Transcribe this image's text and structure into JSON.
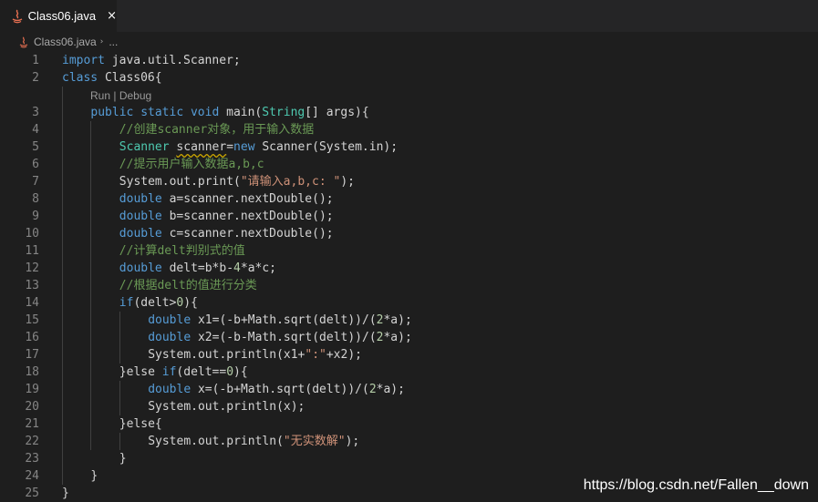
{
  "tab": {
    "label": "Class06.java",
    "close": "×"
  },
  "breadcrumb": {
    "file": "Class06.java",
    "separator": "›",
    "more": "..."
  },
  "codelens": {
    "run": "Run",
    "separator": " | ",
    "debug": "Debug"
  },
  "lines": [
    {
      "n": "1",
      "indent": 0,
      "tokens": [
        {
          "t": "import",
          "c": "kw"
        },
        {
          "t": " java.util.Scanner;"
        }
      ]
    },
    {
      "n": "2",
      "indent": 0,
      "tokens": [
        {
          "t": "class",
          "c": "kw"
        },
        {
          "t": " Class06{"
        }
      ]
    },
    {
      "n": "3",
      "indent": 1,
      "tokens": [
        {
          "t": "public",
          "c": "kw"
        },
        {
          "t": " "
        },
        {
          "t": "static",
          "c": "kw"
        },
        {
          "t": " "
        },
        {
          "t": "void",
          "c": "kw"
        },
        {
          "t": " main("
        },
        {
          "t": "String",
          "c": "type"
        },
        {
          "t": "[] args){"
        }
      ]
    },
    {
      "n": "4",
      "indent": 2,
      "tokens": [
        {
          "t": "//创建scanner对象，用于输入数据",
          "c": "comment"
        }
      ]
    },
    {
      "n": "5",
      "indent": 2,
      "tokens": [
        {
          "t": "Scanner",
          "c": "type"
        },
        {
          "t": " "
        },
        {
          "t": "scanner",
          "c": "warn"
        },
        {
          "t": "="
        },
        {
          "t": "new",
          "c": "kw"
        },
        {
          "t": " Scanner(System.in);"
        }
      ]
    },
    {
      "n": "6",
      "indent": 2,
      "tokens": [
        {
          "t": "//提示用户输入数据a,b,c",
          "c": "comment"
        }
      ]
    },
    {
      "n": "7",
      "indent": 2,
      "tokens": [
        {
          "t": "System.out.print("
        },
        {
          "t": "\"请输入a,b,c: \"",
          "c": "str"
        },
        {
          "t": ");"
        }
      ]
    },
    {
      "n": "8",
      "indent": 2,
      "tokens": [
        {
          "t": "double",
          "c": "kw"
        },
        {
          "t": " a=scanner.nextDouble();"
        }
      ]
    },
    {
      "n": "9",
      "indent": 2,
      "tokens": [
        {
          "t": "double",
          "c": "kw"
        },
        {
          "t": " b=scanner.nextDouble();"
        }
      ]
    },
    {
      "n": "10",
      "indent": 2,
      "tokens": [
        {
          "t": "double",
          "c": "kw"
        },
        {
          "t": " c=scanner.nextDouble();"
        }
      ]
    },
    {
      "n": "11",
      "indent": 2,
      "tokens": [
        {
          "t": "//计算delt判别式的值",
          "c": "comment"
        }
      ]
    },
    {
      "n": "12",
      "indent": 2,
      "tokens": [
        {
          "t": "double",
          "c": "kw"
        },
        {
          "t": " delt=b*b-"
        },
        {
          "t": "4",
          "c": "num"
        },
        {
          "t": "*a*c;"
        }
      ]
    },
    {
      "n": "13",
      "indent": 2,
      "tokens": [
        {
          "t": "//根据delt的值进行分类",
          "c": "comment"
        }
      ]
    },
    {
      "n": "14",
      "indent": 2,
      "tokens": [
        {
          "t": "if",
          "c": "kw"
        },
        {
          "t": "(delt>"
        },
        {
          "t": "0",
          "c": "num"
        },
        {
          "t": "){"
        }
      ]
    },
    {
      "n": "15",
      "indent": 3,
      "tokens": [
        {
          "t": "double",
          "c": "kw"
        },
        {
          "t": " x1=(-b+Math.sqrt(delt))/("
        },
        {
          "t": "2",
          "c": "num"
        },
        {
          "t": "*a);"
        }
      ]
    },
    {
      "n": "16",
      "indent": 3,
      "tokens": [
        {
          "t": "double",
          "c": "kw"
        },
        {
          "t": " x2=(-b-Math.sqrt(delt))/("
        },
        {
          "t": "2",
          "c": "num"
        },
        {
          "t": "*a);"
        }
      ]
    },
    {
      "n": "17",
      "indent": 3,
      "tokens": [
        {
          "t": "System.out.println(x1+"
        },
        {
          "t": "\":\"",
          "c": "str"
        },
        {
          "t": "+x2);"
        }
      ]
    },
    {
      "n": "18",
      "indent": 2,
      "tokens": [
        {
          "t": "}else "
        },
        {
          "t": "if",
          "c": "kw"
        },
        {
          "t": "(delt=="
        },
        {
          "t": "0",
          "c": "num"
        },
        {
          "t": "){"
        }
      ]
    },
    {
      "n": "19",
      "indent": 3,
      "tokens": [
        {
          "t": "double",
          "c": "kw"
        },
        {
          "t": " x=(-b+Math.sqrt(delt))/("
        },
        {
          "t": "2",
          "c": "num"
        },
        {
          "t": "*a);"
        }
      ]
    },
    {
      "n": "20",
      "indent": 3,
      "tokens": [
        {
          "t": "System.out.println(x);"
        }
      ]
    },
    {
      "n": "21",
      "indent": 2,
      "tokens": [
        {
          "t": "}else{"
        }
      ]
    },
    {
      "n": "22",
      "indent": 3,
      "tokens": [
        {
          "t": "System.out.println("
        },
        {
          "t": "\"无实数解\"",
          "c": "str"
        },
        {
          "t": ");"
        }
      ]
    },
    {
      "n": "23",
      "indent": 2,
      "tokens": [
        {
          "t": "}"
        }
      ]
    },
    {
      "n": "24",
      "indent": 1,
      "tokens": [
        {
          "t": "}"
        }
      ]
    },
    {
      "n": "25",
      "indent": 0,
      "tokens": [
        {
          "t": "}"
        }
      ]
    }
  ],
  "watermark": "https://blog.csdn.net/Fallen__down",
  "colors": {
    "kw": "#569cd6",
    "type": "#4ec9b0",
    "comment": "#6a9955",
    "str": "#ce9178",
    "num": "#b5cea8",
    "plain": "#d4d4d4",
    "warn": "#d4d4d4",
    "warn_underline": "#cca700"
  }
}
